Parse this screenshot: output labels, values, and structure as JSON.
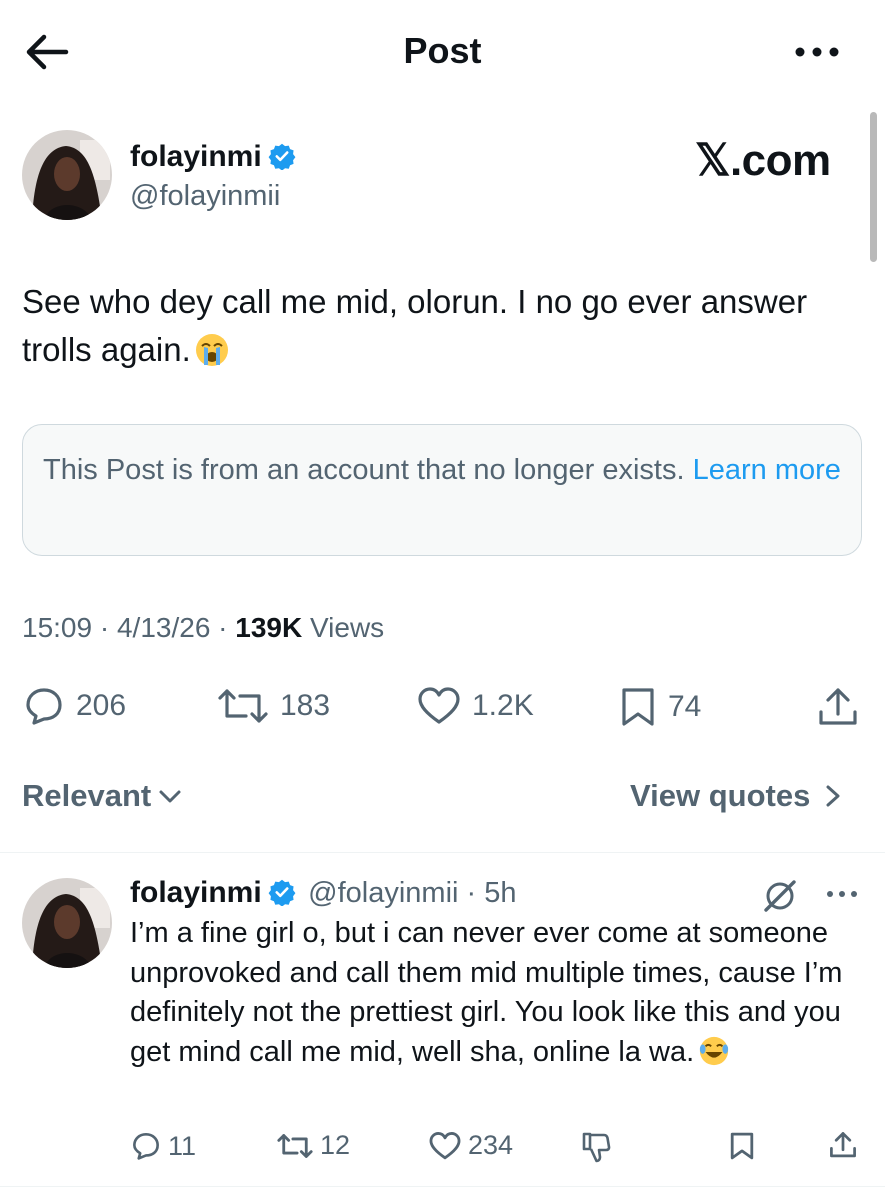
{
  "header": {
    "title": "Post",
    "back_icon": "arrow-left-icon",
    "more_icon": "more-horizontal-icon"
  },
  "post": {
    "author_name": "folayinmi",
    "author_handle": "@folayinmii",
    "watermark": "𝕏.com",
    "text": "See who dey call me mid, olorun. I no go ever answer trolls again.",
    "emoji": "loudly-crying-face",
    "notice_text": "This Post is from an account that no longer exists.",
    "notice_link": "Learn more",
    "time": "15:09",
    "date": "4/13/26",
    "views_count": "139K",
    "views_label": "Views",
    "stats": {
      "replies": "206",
      "reposts": "183",
      "likes": "1.2K",
      "bookmarks": "74"
    }
  },
  "replies_bar": {
    "filter_label": "Relevant",
    "quotes_label": "View quotes"
  },
  "reply": {
    "author_name": "folayinmi",
    "meta": "@folayinmii · 5h",
    "text": "I’m a fine girl o, but i can never ever come at someone unprovoked and call them mid multiple times, cause I’m definitely not the prettiest girl. You look like this and you get mind call me mid, well sha, online la wa.",
    "emoji": "face-with-tears-of-joy",
    "stats": {
      "replies": "11",
      "reposts": "12",
      "likes": "234"
    }
  },
  "colors": {
    "accent": "#1d9bf0",
    "text": "#0f1419",
    "secondary": "#536471",
    "notice_bg": "#f7f9f9"
  }
}
